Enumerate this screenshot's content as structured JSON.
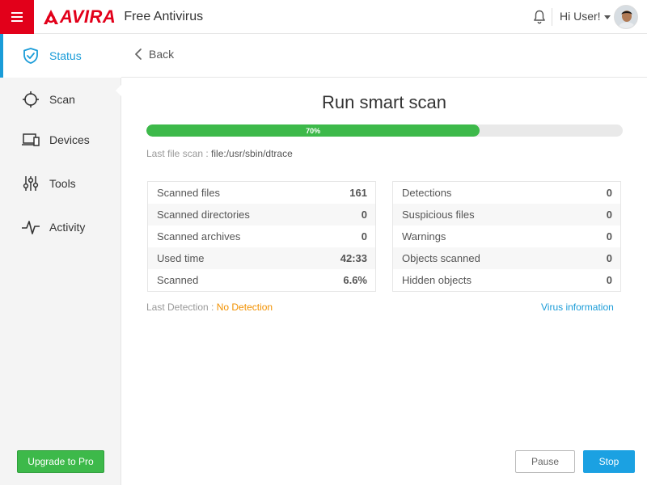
{
  "app": {
    "brand": "AVIRA",
    "product": "Free Antivirus",
    "user_greeting": "Hi User!"
  },
  "colors": {
    "brand_red": "#e2001a",
    "accent_blue": "#1a9cd8",
    "progress_green": "#3db94a",
    "detection_orange": "#f29100"
  },
  "sidebar": {
    "items": [
      {
        "label": "Status",
        "icon": "shield-icon",
        "active": true
      },
      {
        "label": "Scan",
        "icon": "crosshair-icon",
        "active": false
      },
      {
        "label": "Devices",
        "icon": "devices-icon",
        "active": false
      },
      {
        "label": "Tools",
        "icon": "sliders-icon",
        "active": false
      },
      {
        "label": "Activity",
        "icon": "pulse-icon",
        "active": false
      }
    ],
    "upgrade_label": "Upgrade to Pro"
  },
  "main": {
    "back_label": "Back",
    "title": "Run smart scan",
    "progress": {
      "percent": 70,
      "label": "70%"
    },
    "last_file_scan_label": "Last file scan : ",
    "last_file_scan_value": "file:/usr/sbin/dtrace",
    "left_stats": [
      {
        "key": "Scanned files",
        "value": "161"
      },
      {
        "key": "Scanned directories",
        "value": "0"
      },
      {
        "key": "Scanned archives",
        "value": "0"
      },
      {
        "key": "Used time",
        "value": "42:33"
      },
      {
        "key": "Scanned",
        "value": "6.6%"
      }
    ],
    "right_stats": [
      {
        "key": "Detections",
        "value": "0"
      },
      {
        "key": "Suspicious files",
        "value": "0"
      },
      {
        "key": "Warnings",
        "value": "0"
      },
      {
        "key": "Objects scanned",
        "value": "0"
      },
      {
        "key": "Hidden objects",
        "value": "0"
      }
    ],
    "last_detection_label": "Last Detection : ",
    "last_detection_value": "No Detection",
    "virus_info_label": "Virus information",
    "pause_label": "Pause",
    "stop_label": "Stop"
  }
}
